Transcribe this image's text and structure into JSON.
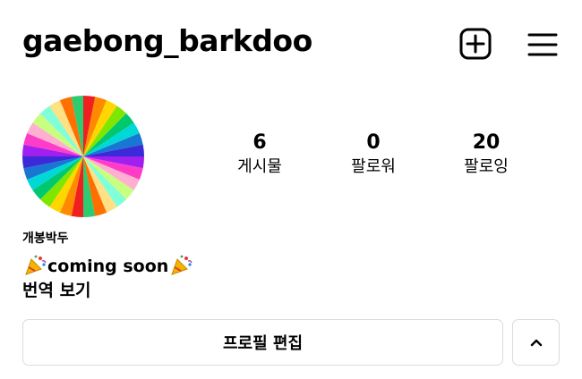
{
  "header": {
    "username": "gaebong_barkdoo",
    "new_post_icon": "plus-square-icon",
    "menu_icon": "hamburger-menu-icon"
  },
  "profile": {
    "avatar_colors": [
      "#f02020",
      "#ff8a00",
      "#ffd600",
      "#7ee600",
      "#00c86e",
      "#00d8d8",
      "#1976d2",
      "#3a2ad8",
      "#a020f0",
      "#ff3cc8",
      "#ffb0d0",
      "#c8ff80",
      "#80ffd8",
      "#ffe082",
      "#ff6f00",
      "#2ecc71"
    ],
    "stats": [
      {
        "count": "6",
        "label": "게시물"
      },
      {
        "count": "0",
        "label": "팔로워"
      },
      {
        "count": "20",
        "label": "팔로잉"
      }
    ],
    "name": "개봉박두",
    "bio_text": "coming soon",
    "bio_emoji_icon": "party-popper-icon",
    "translate_label": "번역 보기"
  },
  "actions": {
    "edit_profile_label": "프로필 편집",
    "expand_icon": "chevron-up-icon"
  }
}
